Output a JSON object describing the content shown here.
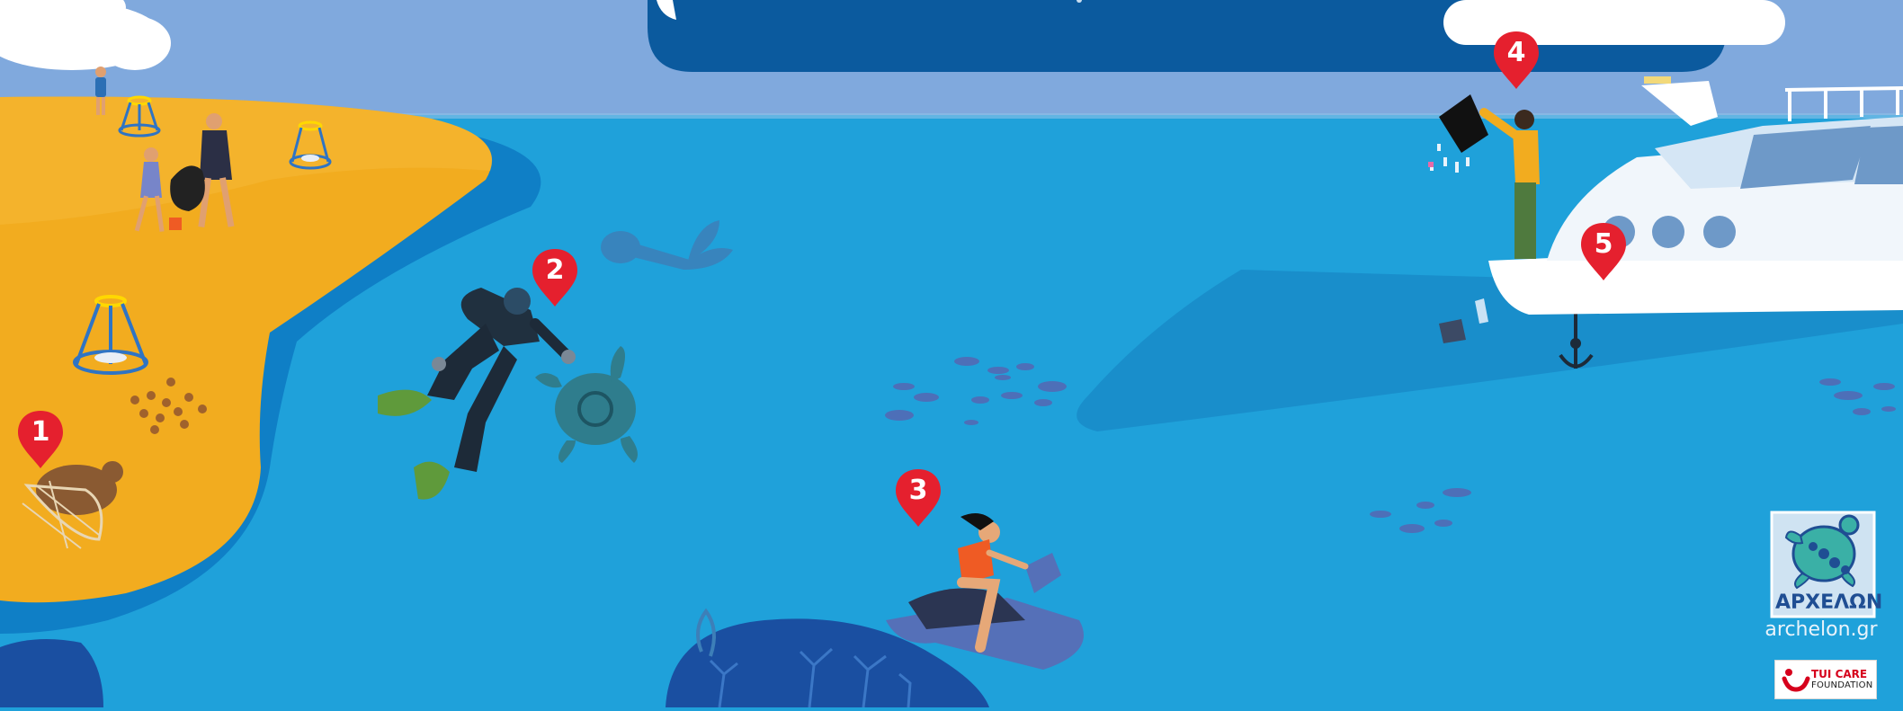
{
  "markers": [
    {
      "number": "1"
    },
    {
      "number": "2"
    },
    {
      "number": "3"
    },
    {
      "number": "4"
    },
    {
      "number": "5"
    }
  ],
  "branding": {
    "archelon_logo_text": "ΑΡΧΕΛΩΝ",
    "site_url": "archelon.gr",
    "tui_name": "TUI CARE",
    "tui_sub": "FOUNDATION"
  },
  "colors": {
    "sky": "#80a9dd",
    "sea": "#1fa1da",
    "sand": "#f2ac1f",
    "shore": "#0f7fc6",
    "banner": "#0b5a9e",
    "marker": "#e5202e",
    "cloud": "#ffffff",
    "deep_reef": "#1a4fa1"
  }
}
